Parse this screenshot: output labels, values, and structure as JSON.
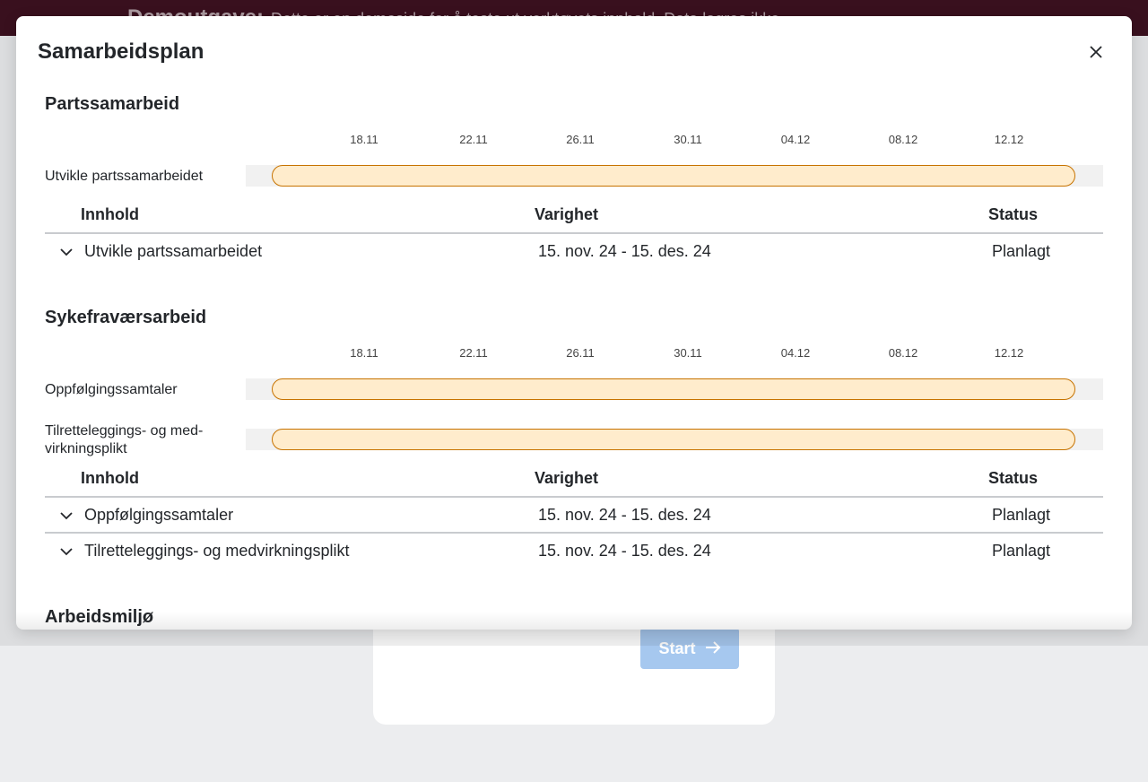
{
  "background": {
    "banner_title": "Demoutgave:",
    "banner_text": "Dette er en demoside for å teste ut verktøyets innhold. Data lagres ikke.",
    "start_label": "Start"
  },
  "modal": {
    "title": "Samarbeidsplan",
    "close_icon": "close-icon"
  },
  "table_headers": {
    "content": "Innhold",
    "duration": "Varighet",
    "status": "Status"
  },
  "ticks": [
    "18.11",
    "22.11",
    "26.11",
    "30.11",
    "04.12",
    "08.12",
    "12.12"
  ],
  "sections": [
    {
      "title": "Partssamarbeid",
      "rows": [
        {
          "label": "Utvikle partssamarbeidet",
          "start_fraction": 0.0,
          "end_fraction": 1.0
        }
      ],
      "items": [
        {
          "name": "Utvikle partssamarbeidet",
          "duration": "15. nov. 24 - 15. des. 24",
          "status": "Planlagt"
        }
      ]
    },
    {
      "title": "Sykefraværsarbeid",
      "rows": [
        {
          "label": "Oppfølgingssamtaler",
          "start_fraction": 0.0,
          "end_fraction": 1.0
        },
        {
          "label": "Tilretteleggings- og med-virkningsplikt",
          "start_fraction": 0.0,
          "end_fraction": 1.0
        }
      ],
      "items": [
        {
          "name": "Oppfølgingssamtaler",
          "duration": "15. nov. 24 - 15. des. 24",
          "status": "Planlagt"
        },
        {
          "name": "Tilretteleggings- og medvirkningsplikt",
          "duration": "15. nov. 24 - 15. des. 24",
          "status": "Planlagt"
        }
      ]
    },
    {
      "title": "Arbeidsmiljø",
      "rows": [],
      "items": []
    }
  ]
}
